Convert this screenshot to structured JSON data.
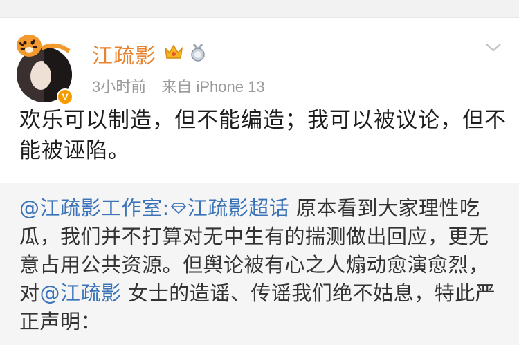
{
  "post": {
    "username": "江疏影",
    "time": "3小时前",
    "source": "来自 iPhone 13",
    "text": "欢乐可以制造，但不能编造；我可以被议论，但不能被诬陷。"
  },
  "repost": {
    "author_mention": "@江疏影工作室:",
    "topic": "江疏影超话",
    "text_part1": " 原本看到大家理性吃瓜，我们并不打算对无中生有的揣测做出回应，更无意占用公共资源。但舆论被有心之人煽动愈演愈烈，对",
    "mention2": "@江疏影",
    "text_part2": " 女士的造谣、传谣我们绝不姑息，特此严正声明："
  },
  "colors": {
    "username": "#e8822c",
    "link": "#3b73b8",
    "meta": "#9a9a9a",
    "repost_bg": "#f5f5f5"
  },
  "icons": [
    "crown-icon",
    "medal-icon",
    "chevron-down-icon",
    "verified-v-icon",
    "diamond-topic-icon"
  ]
}
